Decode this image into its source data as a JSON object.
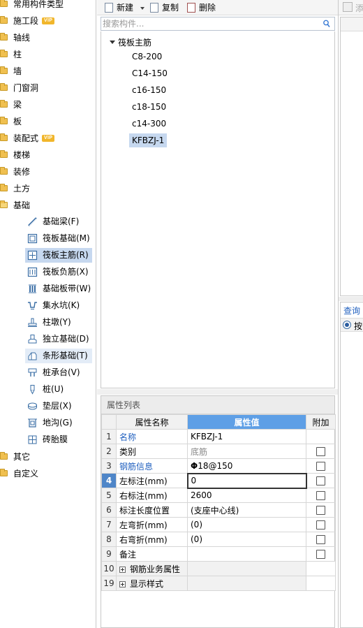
{
  "sidebar": {
    "categories": [
      {
        "label": "常用构件类型",
        "vip": false,
        "open": false
      },
      {
        "label": "施工段",
        "vip": true,
        "open": false
      },
      {
        "label": "轴线",
        "vip": false,
        "open": false
      },
      {
        "label": "柱",
        "vip": false,
        "open": false
      },
      {
        "label": "墙",
        "vip": false,
        "open": false
      },
      {
        "label": "门窗洞",
        "vip": false,
        "open": false
      },
      {
        "label": "梁",
        "vip": false,
        "open": false
      },
      {
        "label": "板",
        "vip": false,
        "open": false
      },
      {
        "label": "装配式",
        "vip": true,
        "open": false
      },
      {
        "label": "楼梯",
        "vip": false,
        "open": false
      },
      {
        "label": "装修",
        "vip": false,
        "open": false
      },
      {
        "label": "土方",
        "vip": false,
        "open": false
      },
      {
        "label": "基础",
        "vip": false,
        "open": true
      }
    ],
    "vip_label": "VIP",
    "foundation_items": [
      {
        "label": "基础梁(F)",
        "icon": "beam-icon"
      },
      {
        "label": "筏板基础(M)",
        "icon": "raft-slab-icon"
      },
      {
        "label": "筏板主筋(R)",
        "icon": "raft-main-rebar-icon",
        "selected": true
      },
      {
        "label": "筏板负筋(X)",
        "icon": "raft-negative-rebar-icon"
      },
      {
        "label": "基础板带(W)",
        "icon": "slab-strip-icon"
      },
      {
        "label": "集水坑(K)",
        "icon": "sump-pit-icon"
      },
      {
        "label": "柱墩(Y)",
        "icon": "column-pier-icon"
      },
      {
        "label": "独立基础(D)",
        "icon": "isolated-footing-icon"
      },
      {
        "label": "条形基础(T)",
        "icon": "strip-footing-icon",
        "hover": true
      },
      {
        "label": "桩承台(V)",
        "icon": "pile-cap-icon"
      },
      {
        "label": "桩(U)",
        "icon": "pile-icon"
      },
      {
        "label": "垫层(X)",
        "icon": "cushion-layer-icon"
      },
      {
        "label": "地沟(G)",
        "icon": "trench-icon"
      },
      {
        "label": "砖胎膜",
        "icon": "brick-mold-icon"
      }
    ],
    "bottom_categories": [
      {
        "label": "其它"
      },
      {
        "label": "自定义"
      }
    ]
  },
  "toolbar": {
    "new_label": "新建",
    "copy_label": "复制",
    "delete_label": "删除"
  },
  "search": {
    "placeholder": "搜索构件..."
  },
  "component_list": {
    "group_label": "筏板主筋",
    "items": [
      "C8-200",
      "C14-150",
      "c16-150",
      "c18-150",
      "c14-300",
      "KFBZJ-1"
    ],
    "selected_index": 5
  },
  "properties": {
    "title": "属性列表",
    "headers": {
      "name": "属性名称",
      "value": "属性值",
      "extra": "附加"
    },
    "rows": [
      {
        "index": "1",
        "name": "名称",
        "value": "KFBZJ-1",
        "has_checkbox": false,
        "name_blue": true
      },
      {
        "index": "2",
        "name": "类别",
        "value": "底筋",
        "has_checkbox": true,
        "value_grey": true
      },
      {
        "index": "3",
        "name": "钢筋信息",
        "value_symbol": "Φ",
        "value": "18@150",
        "has_checkbox": true,
        "name_blue": true
      },
      {
        "index": "4",
        "name": "左标注(mm)",
        "value": "0",
        "has_checkbox": true,
        "active": true
      },
      {
        "index": "5",
        "name": "右标注(mm)",
        "value": "2600",
        "has_checkbox": true
      },
      {
        "index": "6",
        "name": "标注长度位置",
        "value": "(支座中心线)",
        "has_checkbox": true
      },
      {
        "index": "7",
        "name": "左弯折(mm)",
        "value": "(0)",
        "has_checkbox": true
      },
      {
        "index": "8",
        "name": "右弯折(mm)",
        "value": "(0)",
        "has_checkbox": true
      },
      {
        "index": "9",
        "name": "备注",
        "value": "",
        "has_checkbox": true
      },
      {
        "index": "10",
        "name": "钢筋业务属性",
        "value": "",
        "has_checkbox": false,
        "group": true
      },
      {
        "index": "19",
        "name": "显示样式",
        "value": "",
        "has_checkbox": false,
        "group": true
      }
    ]
  },
  "right_panel": {
    "toolbar_label": "添",
    "query_label": "查询",
    "radio_label": "按"
  }
}
